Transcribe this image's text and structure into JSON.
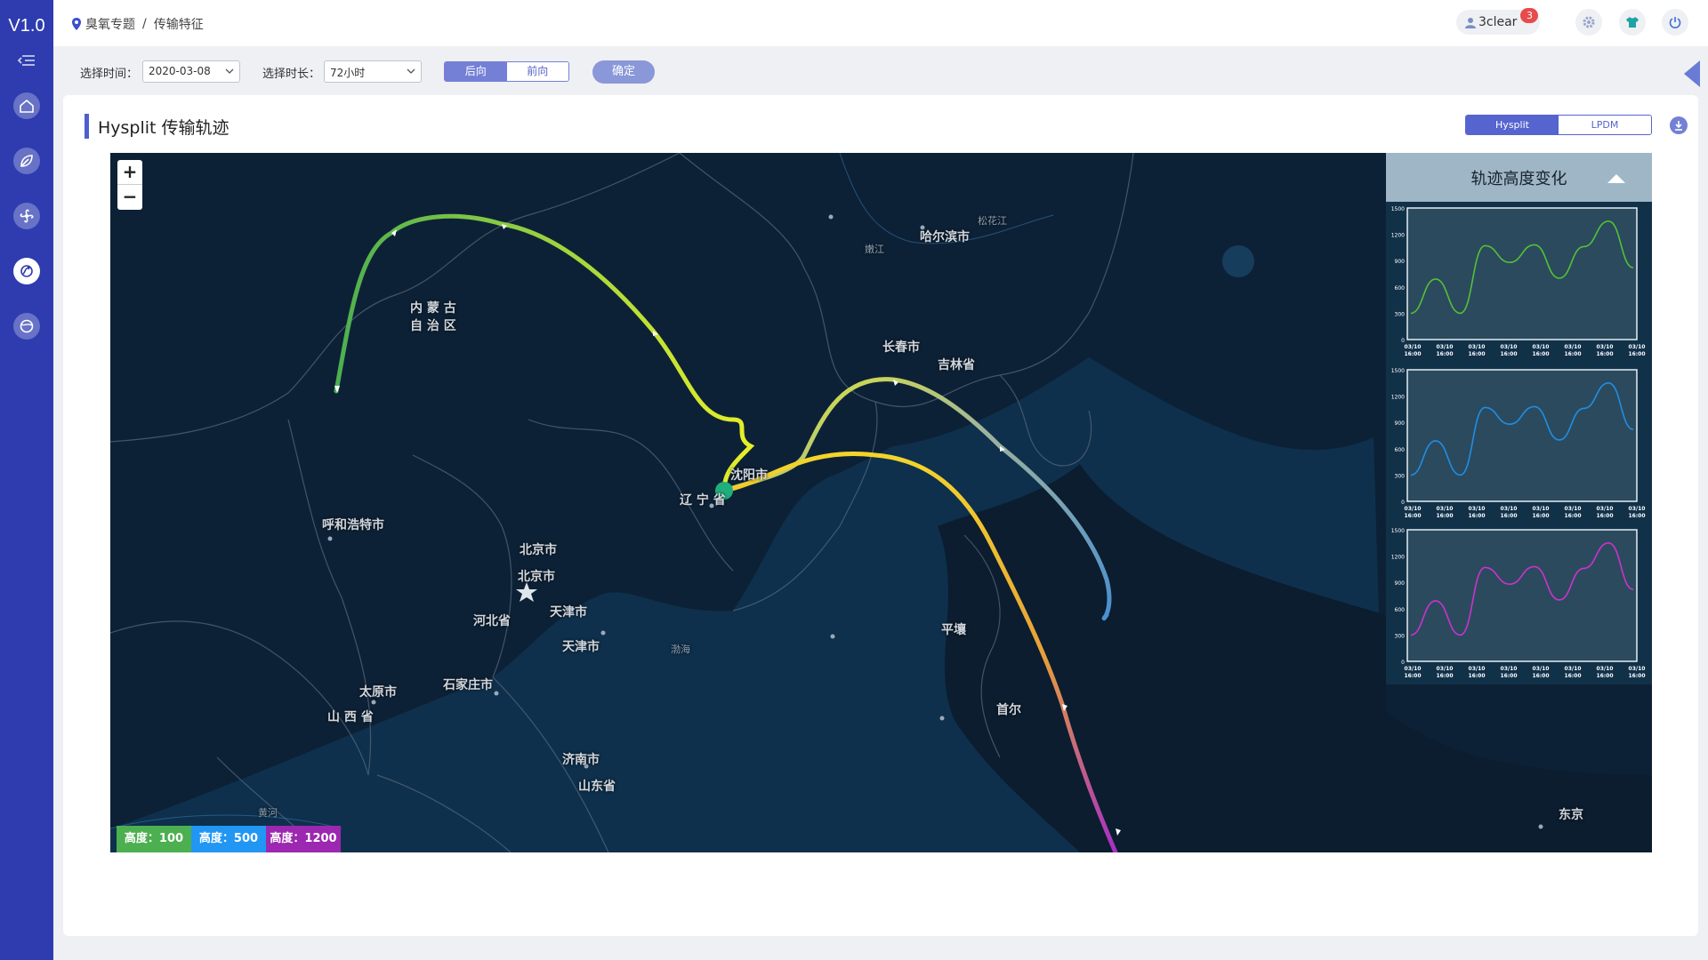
{
  "sidebar": {
    "version": "V1.0",
    "items": [
      {
        "icon": "home-icon"
      },
      {
        "icon": "leaf-icon"
      },
      {
        "icon": "fan-icon"
      },
      {
        "icon": "transport-icon",
        "active": true
      },
      {
        "icon": "globe-icon"
      }
    ]
  },
  "header": {
    "breadcrumb_root": "臭氧专题",
    "breadcrumb_sep": "/",
    "breadcrumb_current": "传输特征",
    "user": "3clear",
    "notifications": "3"
  },
  "filters": {
    "time_label": "选择时间：",
    "time_value": "2020-03-08",
    "duration_label": "选择时长：",
    "duration_value": "72小时",
    "direction_options": [
      "后向",
      "前向"
    ],
    "direction_selected": "后向",
    "confirm_label": "确定"
  },
  "panel": {
    "title": "Hysplit 传输轨迹",
    "model_options": [
      "Hysplit",
      "LPDM"
    ],
    "model_selected": "Hysplit"
  },
  "map": {
    "zoom_in": "+",
    "zoom_out": "−",
    "legend": [
      {
        "label": "高度：100",
        "color": "#4caf50"
      },
      {
        "label": "高度：500",
        "color": "#2196f3"
      },
      {
        "label": "高度：1200",
        "color": "#9c27b0"
      }
    ],
    "cities": [
      "哈尔滨市",
      "松花江",
      "嫩江",
      "长春市",
      "吉林省",
      "内 蒙 古",
      "自 治 区",
      "沈阳市",
      "辽 宁 省",
      "呼和浩特市",
      "北京市",
      "北京市",
      "天津市",
      "天津市",
      "河北省",
      "渤海",
      "平壤",
      "石家庄市",
      "太原市",
      "山 西 省",
      "首尔",
      "济南市",
      "山东省",
      "黄河",
      "东京"
    ]
  },
  "elevation": {
    "title": "轨迹高度变化",
    "y_ticks": [
      "1500",
      "1200",
      "900",
      "600",
      "300",
      "0"
    ],
    "x_tick_date": "03/10",
    "x_tick_time": "16:00"
  },
  "chart_data": [
    {
      "type": "line",
      "title": "",
      "ylim": [
        0,
        1500
      ],
      "x": [
        "03/10 16:00",
        "03/10 16:00",
        "03/10 16:00",
        "03/10 16:00",
        "03/10 16:00",
        "03/10 16:00",
        "03/10 16:00",
        "03/10 16:00"
      ],
      "series": [
        {
          "values": [
            300,
            690,
            300,
            1070,
            880,
            1080,
            700,
            1060,
            1350,
            820
          ],
          "color": "#52c234"
        }
      ]
    },
    {
      "type": "line",
      "title": "",
      "ylim": [
        0,
        1500
      ],
      "x": [
        "03/10 16:00",
        "03/10 16:00",
        "03/10 16:00",
        "03/10 16:00",
        "03/10 16:00",
        "03/10 16:00",
        "03/10 16:00",
        "03/10 16:00"
      ],
      "series": [
        {
          "values": [
            300,
            690,
            300,
            1070,
            880,
            1080,
            700,
            1060,
            1350,
            820
          ],
          "color": "#1e8fe6"
        }
      ]
    },
    {
      "type": "line",
      "title": "",
      "ylim": [
        0,
        1500
      ],
      "x": [
        "03/10 16:00",
        "03/10 16:00",
        "03/10 16:00",
        "03/10 16:00",
        "03/10 16:00",
        "03/10 16:00",
        "03/10 16:00",
        "03/10 16:00"
      ],
      "series": [
        {
          "values": [
            300,
            690,
            300,
            1070,
            880,
            1080,
            700,
            1060,
            1350,
            820
          ],
          "color": "#cc33cc"
        }
      ]
    }
  ]
}
